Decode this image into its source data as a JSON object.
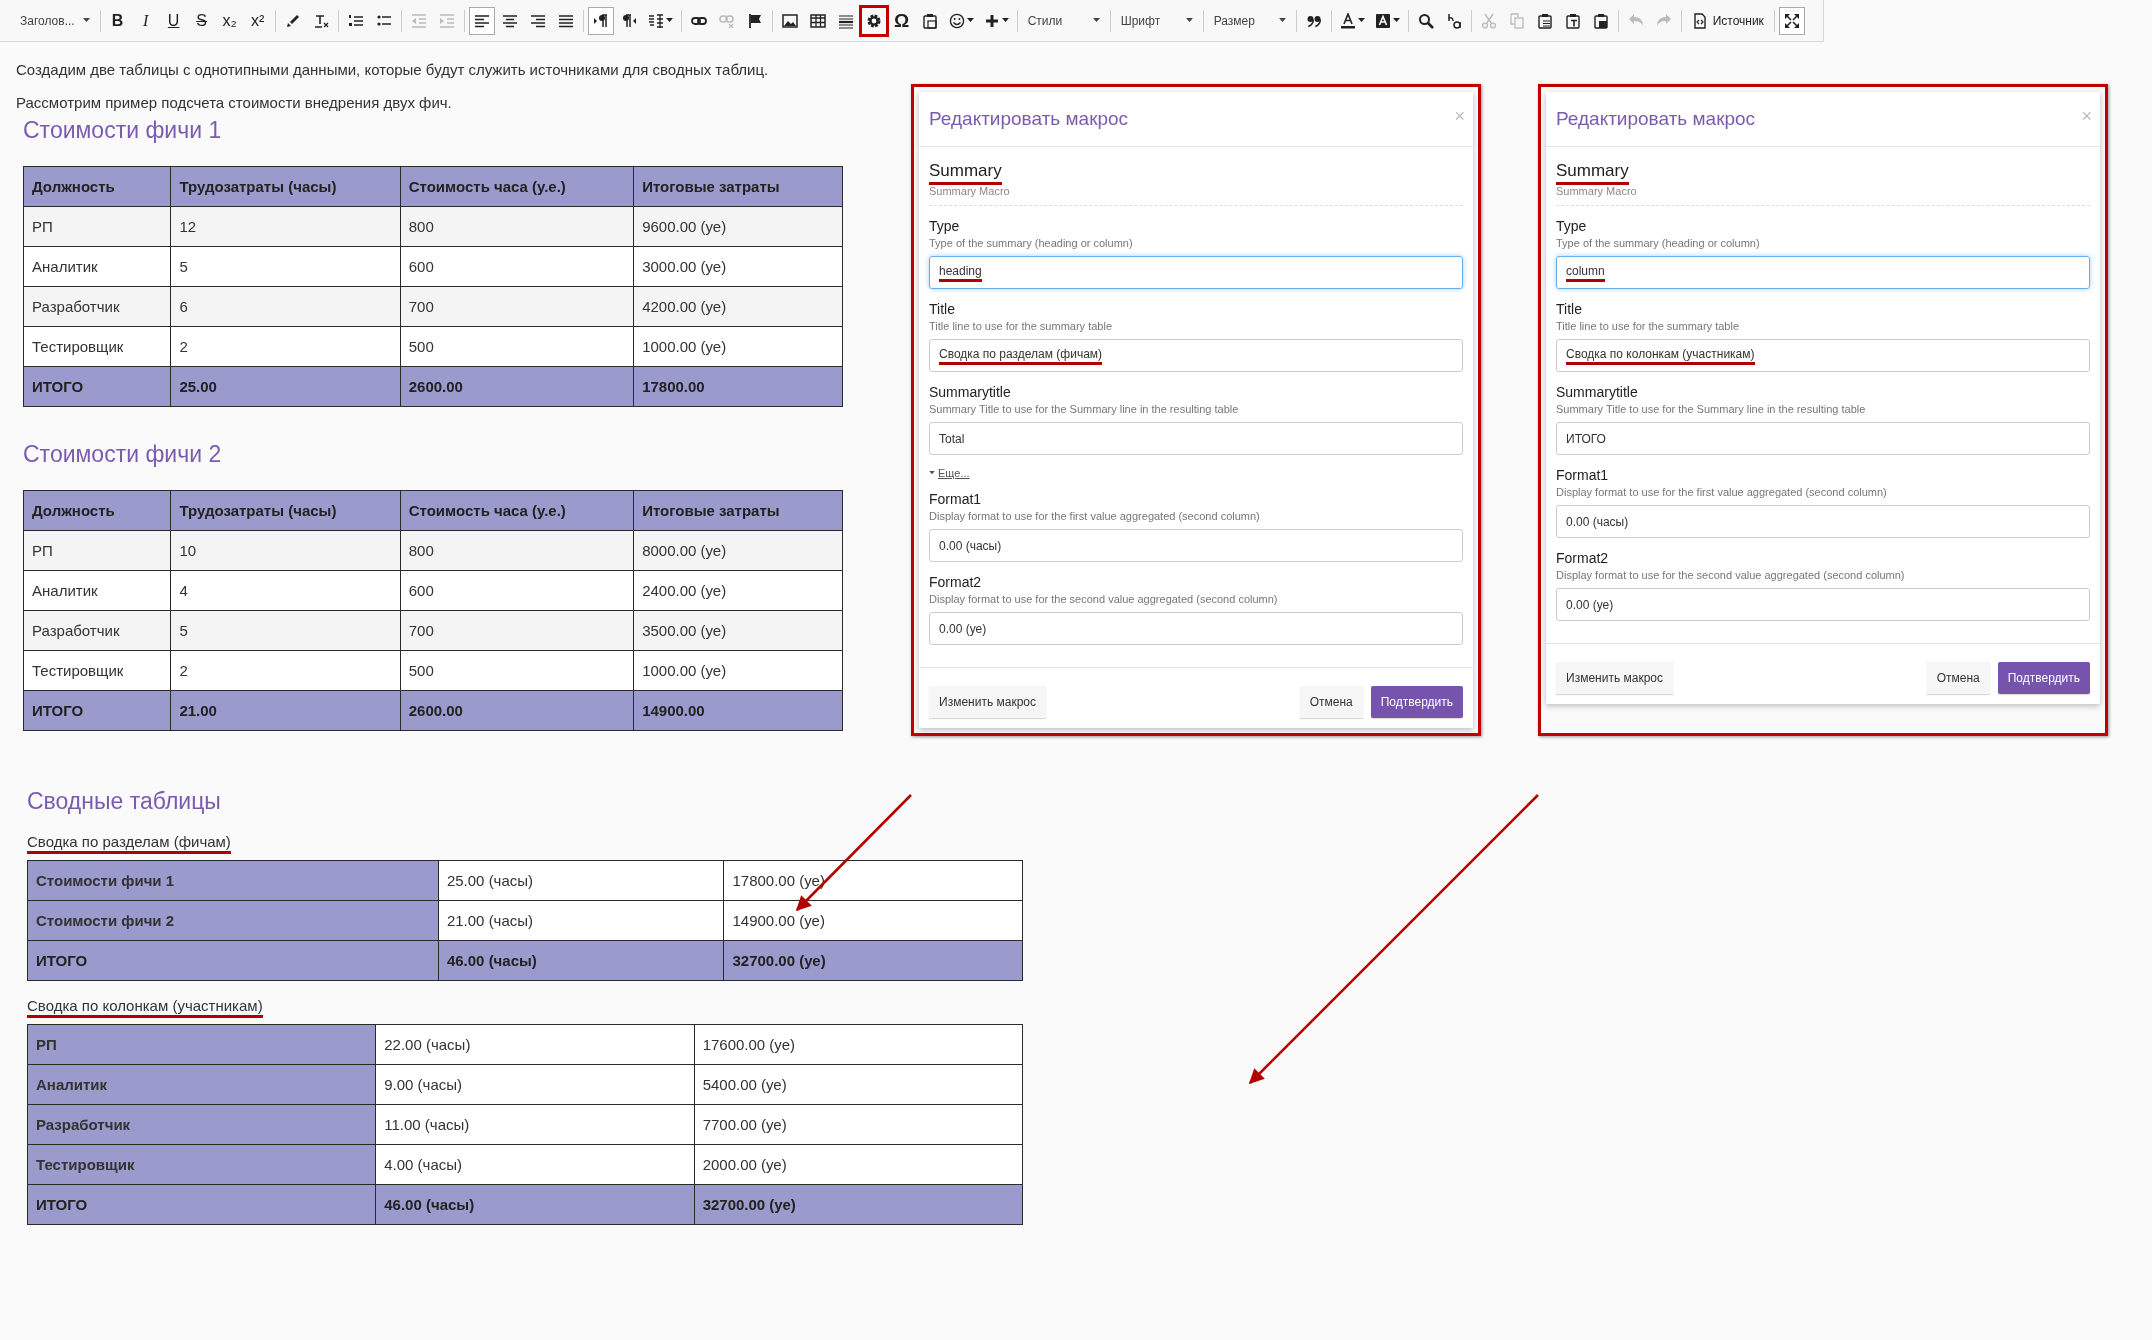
{
  "toolbar": {
    "groups": [
      [
        {
          "kind": "dropdown",
          "label": "Заголов..."
        }
      ],
      [
        {
          "kind": "glyph",
          "text": "B",
          "selected": false,
          "disabled": false
        },
        {
          "kind": "glyph",
          "text": "I",
          "selected": false,
          "disabled": false
        },
        {
          "kind": "glyph",
          "text": "U",
          "selected": false,
          "disabled": false
        },
        {
          "kind": "glyph",
          "text": "S",
          "selected": false,
          "disabled": false
        },
        {
          "kind": "glyph",
          "text": "x₂",
          "selected": false,
          "disabled": false
        },
        {
          "kind": "glyph",
          "text": "x²",
          "selected": false,
          "disabled": false
        }
      ],
      [
        {
          "kind": "icon",
          "selected": false,
          "disabled": false
        },
        {
          "kind": "icon",
          "selected": false,
          "disabled": false
        }
      ],
      [
        {
          "kind": "icon",
          "selected": false,
          "disabled": false
        },
        {
          "kind": "icon",
          "selected": false,
          "disabled": false
        }
      ],
      [
        {
          "kind": "icon",
          "selected": false,
          "disabled": true
        },
        {
          "kind": "icon",
          "selected": false,
          "disabled": true
        }
      ],
      [
        {
          "kind": "icon",
          "selected": true,
          "disabled": false
        },
        {
          "kind": "icon",
          "selected": false,
          "disabled": false
        },
        {
          "kind": "icon",
          "selected": false,
          "disabled": false
        },
        {
          "kind": "icon",
          "selected": false,
          "disabled": false
        }
      ],
      [
        {
          "kind": "icon",
          "selected": true,
          "disabled": false
        },
        {
          "kind": "icon",
          "selected": false,
          "disabled": false
        },
        {
          "kind": "icon",
          "selected": false,
          "disabled": false
        }
      ],
      [
        {
          "kind": "icon",
          "selected": false,
          "disabled": false
        },
        {
          "kind": "icon",
          "selected": false,
          "disabled": true
        },
        {
          "kind": "icon",
          "selected": false,
          "disabled": false
        }
      ],
      [
        {
          "kind": "icon",
          "selected": false,
          "disabled": false
        },
        {
          "kind": "icon",
          "selected": false,
          "disabled": false
        },
        {
          "kind": "icon",
          "selected": false,
          "disabled": false
        },
        {
          "kind": "icon",
          "selected": false,
          "disabled": false,
          "highlighted": true
        },
        {
          "kind": "glyph",
          "text": "Ω",
          "selected": false,
          "disabled": false
        },
        {
          "kind": "icon",
          "selected": false,
          "disabled": false
        },
        {
          "kind": "icon",
          "selected": false,
          "disabled": false
        },
        {
          "kind": "icon",
          "selected": false,
          "disabled": false
        }
      ],
      [
        {
          "kind": "dropdown",
          "label": "Стили"
        }
      ],
      [
        {
          "kind": "dropdown",
          "label": "Шрифт"
        }
      ],
      [
        {
          "kind": "dropdown",
          "label": "Размер"
        }
      ],
      [
        {
          "kind": "icon",
          "selected": false,
          "disabled": false
        }
      ],
      [
        {
          "kind": "icon",
          "selected": false,
          "disabled": false
        },
        {
          "kind": "icon",
          "selected": false,
          "disabled": false
        }
      ],
      [
        {
          "kind": "icon",
          "selected": false,
          "disabled": false
        },
        {
          "kind": "icon",
          "selected": false,
          "disabled": false
        }
      ],
      [
        {
          "kind": "icon",
          "selected": false,
          "disabled": true
        },
        {
          "kind": "icon",
          "selected": false,
          "disabled": true
        },
        {
          "kind": "icon",
          "selected": false,
          "disabled": false
        },
        {
          "kind": "icon",
          "selected": false,
          "disabled": false
        },
        {
          "kind": "icon",
          "selected": false,
          "disabled": false
        }
      ],
      [
        {
          "kind": "icon",
          "selected": false,
          "disabled": true
        },
        {
          "kind": "icon",
          "selected": false,
          "disabled": true
        }
      ],
      [
        {
          "kind": "text-button",
          "label": "Источник",
          "selected": false,
          "disabled": false
        }
      ],
      [
        {
          "kind": "icon",
          "selected": true,
          "disabled": false
        }
      ]
    ]
  },
  "intro": [
    "Создадим две таблицы с однотипными данными, которые будут служить источниками для сводных таблиц.",
    "Рассмотрим пример подсчета стоимости внедрения двух фич."
  ],
  "source_tables": [
    {
      "heading": "Стоимости фичи 1",
      "columns": [
        "Должность",
        "Трудозатраты (часы)",
        "Стоимость часа (у.е.)",
        "Итоговые затраты"
      ],
      "rows": [
        [
          "РП",
          "12",
          "800",
          "9600.00 (уе)"
        ],
        [
          "Аналитик",
          "5",
          "600",
          "3000.00 (уе)"
        ],
        [
          "Разработчик",
          "6",
          "700",
          "4200.00 (уе)"
        ],
        [
          "Тестировщик",
          "2",
          "500",
          "1000.00 (уе)"
        ]
      ],
      "total": [
        "ИТОГО",
        "25.00",
        "2600.00",
        "17800.00"
      ]
    },
    {
      "heading": "Стоимости фичи 2",
      "columns": [
        "Должность",
        "Трудозатраты (часы)",
        "Стоимость часа (у.е.)",
        "Итоговые затраты"
      ],
      "rows": [
        [
          "РП",
          "10",
          "800",
          "8000.00 (уе)"
        ],
        [
          "Аналитик",
          "4",
          "600",
          "2400.00 (уе)"
        ],
        [
          "Разработчик",
          "5",
          "700",
          "3500.00 (уе)"
        ],
        [
          "Тестировщик",
          "2",
          "500",
          "1000.00 (уе)"
        ]
      ],
      "total": [
        "ИТОГО",
        "21.00",
        "2600.00",
        "14900.00"
      ]
    }
  ],
  "dialogs": [
    {
      "title": "Редактировать макрос",
      "close": "×",
      "macro": {
        "name": "Summary",
        "description": "Summary Macro",
        "annotated": true
      },
      "items": [
        {
          "kind": "field",
          "label": "Type",
          "description": "Type of the summary (heading or column)",
          "value": "heading",
          "focused": true,
          "annotated": true
        },
        {
          "kind": "field",
          "label": "Title",
          "description": "Title line to use for the summary table",
          "value": "Сводка по разделам (фичам)",
          "focused": false,
          "annotated": true
        },
        {
          "kind": "field",
          "label": "Summarytitle",
          "description": "Summary Title to use for the Summary line in the resulting table",
          "value": "Total",
          "focused": false,
          "annotated": false
        },
        {
          "kind": "link",
          "label": "Еще..."
        },
        {
          "kind": "field",
          "label": "Format1",
          "description": "Display format to use for the first value aggregated (second column)",
          "value": "0.00 (часы)",
          "focused": false,
          "annotated": false
        },
        {
          "kind": "field",
          "label": "Format2",
          "description": "Display format to use for the second value aggregated (second column)",
          "value": "0.00 (уе)",
          "focused": false,
          "annotated": false
        }
      ],
      "buttons": [
        {
          "label": "Изменить макрос",
          "kind": "plain"
        },
        {
          "label": "Отмена",
          "kind": "plain"
        },
        {
          "label": "Подтвердить",
          "kind": "primary"
        }
      ]
    },
    {
      "title": "Редактировать макрос",
      "close": "×",
      "macro": {
        "name": "Summary",
        "description": "Summary Macro",
        "annotated": true
      },
      "items": [
        {
          "kind": "field",
          "label": "Type",
          "description": "Type of the summary (heading or column)",
          "value": "column",
          "focused": true,
          "annotated": true
        },
        {
          "kind": "field",
          "label": "Title",
          "description": "Title line to use for the summary table",
          "value": "Сводка по колонкам (участникам)",
          "focused": false,
          "annotated": true
        },
        {
          "kind": "field",
          "label": "Summarytitle",
          "description": "Summary Title to use for the Summary line in the resulting table",
          "value": "ИТОГО",
          "focused": false,
          "annotated": false
        },
        {
          "kind": "field",
          "label": "Format1",
          "description": "Display format to use for the first value aggregated (second column)",
          "value": "0.00 (часы)",
          "focused": false,
          "annotated": false
        },
        {
          "kind": "field",
          "label": "Format2",
          "description": "Display format to use for the second value aggregated (second column)",
          "value": "0.00 (уе)",
          "focused": false,
          "annotated": false
        }
      ],
      "buttons": [
        {
          "label": "Изменить макрос",
          "kind": "plain"
        },
        {
          "label": "Отмена",
          "kind": "plain"
        },
        {
          "label": "Подтвердить",
          "kind": "primary"
        }
      ]
    }
  ],
  "summary": {
    "heading": "Сводные таблицы",
    "tables": [
      {
        "title": "Сводка по разделам (фичам)",
        "annotated": true,
        "rows": [
          [
            "Стоимости фичи 1",
            "25.00 (часы)",
            "17800.00 (уе)"
          ],
          [
            "Стоимости фичи 2",
            "21.00 (часы)",
            "14900.00 (уе)"
          ]
        ],
        "total": [
          "ИТОГО",
          "46.00 (часы)",
          "32700.00 (уе)"
        ]
      },
      {
        "title": "Сводка по колонкам (участникам)",
        "annotated": true,
        "rows": [
          [
            "РП",
            "22.00 (часы)",
            "17600.00 (уе)"
          ],
          [
            "Аналитик",
            "9.00 (часы)",
            "5400.00 (уе)"
          ],
          [
            "Разработчик",
            "11.00 (часы)",
            "7700.00 (уе)"
          ],
          [
            "Тестировщик",
            "4.00 (часы)",
            "2000.00 (уе)"
          ]
        ],
        "total": [
          "ИТОГО",
          "46.00 (часы)",
          "32700.00 (уе)"
        ]
      }
    ]
  }
}
